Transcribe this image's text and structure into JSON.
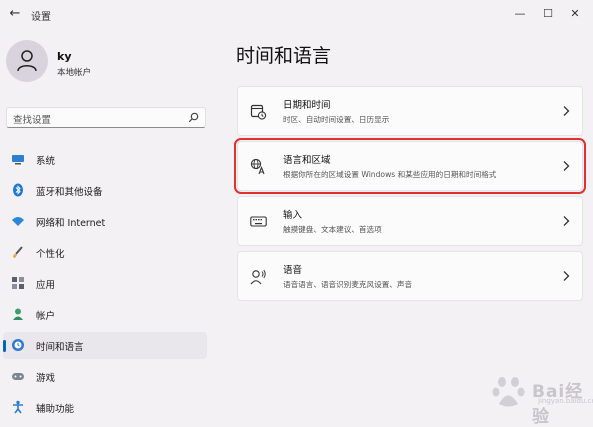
{
  "window": {
    "back_glyph": "←",
    "title": "设置",
    "minimize_glyph": "—",
    "maximize_glyph": "☐",
    "close_glyph": "✕"
  },
  "user": {
    "name": "ky",
    "account_type": "本地帐户"
  },
  "search": {
    "placeholder": "查找设置"
  },
  "sidebar": {
    "active_index": 6,
    "items": [
      {
        "label": "系统",
        "icon": "display-icon"
      },
      {
        "label": "蓝牙和其他设备",
        "icon": "bluetooth-icon"
      },
      {
        "label": "网络和 Internet",
        "icon": "wifi-icon"
      },
      {
        "label": "个性化",
        "icon": "brush-icon"
      },
      {
        "label": "应用",
        "icon": "apps-icon"
      },
      {
        "label": "帐户",
        "icon": "person-icon"
      },
      {
        "label": "时间和语言",
        "icon": "globe-clock-icon"
      },
      {
        "label": "游戏",
        "icon": "gamepad-icon"
      },
      {
        "label": "辅助功能",
        "icon": "accessibility-icon"
      }
    ]
  },
  "main": {
    "title": "时间和语言",
    "cards": [
      {
        "title": "日期和时间",
        "description": "时区、自动时间设置、日历显示",
        "icon": "calendar-clock-icon"
      },
      {
        "title": "语言和区域",
        "description": "根据你所在的区域设置 Windows 和某些应用的日期和时间格式",
        "icon": "language-icon",
        "highlighted": true
      },
      {
        "title": "输入",
        "description": "触摸键盘、文本建议、首选项",
        "icon": "keyboard-icon"
      },
      {
        "title": "语音",
        "description": "语音语言、语音识别麦克风设置、声音",
        "icon": "speech-icon"
      }
    ]
  },
  "watermark": {
    "text": "Bai经验",
    "sub": "jingyan.baidu.com"
  },
  "colors": {
    "accent": "#0067c0",
    "highlight_border": "#e0312f",
    "background": "#f3f1f4"
  }
}
